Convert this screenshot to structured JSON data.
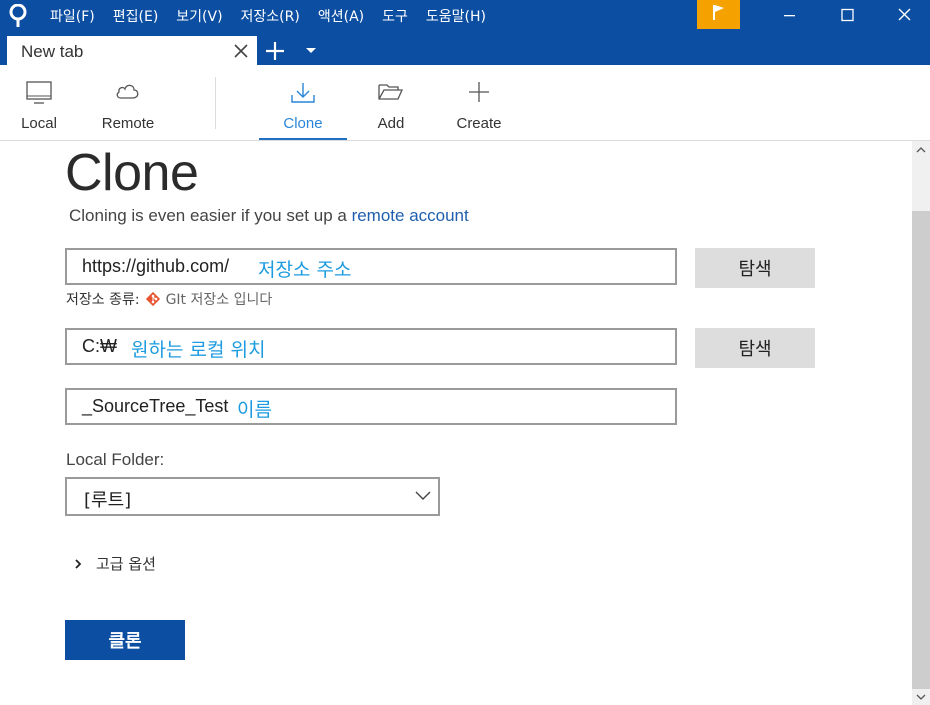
{
  "menu": {
    "items": [
      "파일(F)",
      "편집(E)",
      "보기(V)",
      "저장소(R)",
      "액션(A)",
      "도구",
      "도움말(H)"
    ]
  },
  "tabs": [
    {
      "label": "New tab"
    }
  ],
  "toolbar": {
    "items": [
      {
        "label": "Local",
        "icon": "monitor-icon"
      },
      {
        "label": "Remote",
        "icon": "cloud-icon"
      },
      {
        "label": "Clone",
        "icon": "download-icon",
        "active": true
      },
      {
        "label": "Add",
        "icon": "folder-open-icon"
      },
      {
        "label": "Create",
        "icon": "plus-icon"
      }
    ]
  },
  "clone": {
    "title": "Clone",
    "subtitle_prefix": "Cloning is even easier if you set up a ",
    "subtitle_link": "remote account",
    "source_url": {
      "value": "https://github.com/",
      "hint": "저장소 주소"
    },
    "browse_label": "탐색",
    "repo_type_label": "저장소 종류:",
    "repo_type_value": "GIt 저장소 입니다",
    "destination": {
      "value": "C:₩",
      "hint": "원하는 로컬 위치"
    },
    "name": {
      "value": "_SourceTree_Test",
      "hint": "이름"
    },
    "local_folder_label": "Local Folder:",
    "local_folder_value": "[루트]",
    "advanced_label": "고급 옵션",
    "clone_button": "클론"
  },
  "colors": {
    "titlebar": "#0b4ea2",
    "flag": "#f5a200",
    "hint": "#1c9be0",
    "link": "#1f5fae",
    "primary_button": "#0b4ea2"
  }
}
